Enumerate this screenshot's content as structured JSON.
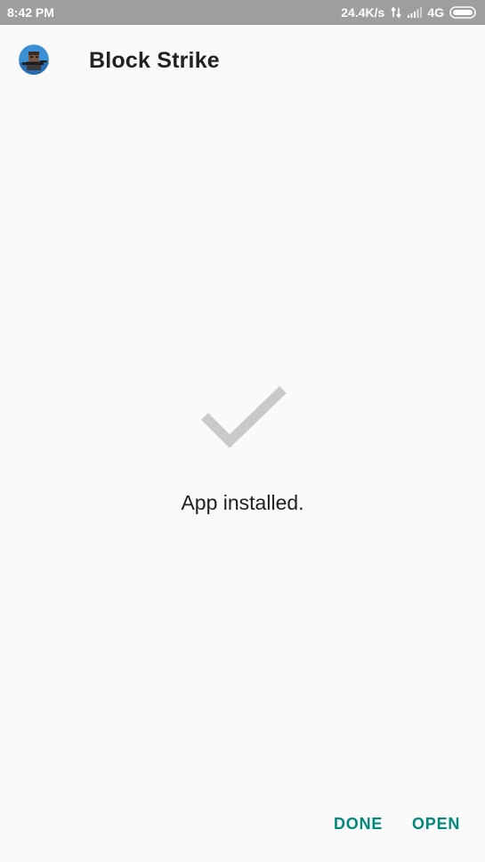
{
  "status_bar": {
    "time": "8:42 PM",
    "net_speed": "24.4K/s",
    "network_type": "4G",
    "icons": [
      "data-transfer-icon",
      "signal-icon",
      "battery-icon"
    ],
    "background_color": "#9e9e9e"
  },
  "app": {
    "name": "Block Strike",
    "icon": "app-icon"
  },
  "main": {
    "status_icon": "checkmark-icon",
    "message": "App installed."
  },
  "actions": {
    "done_label": "DONE",
    "open_label": "OPEN",
    "accent_color": "#00897b"
  }
}
